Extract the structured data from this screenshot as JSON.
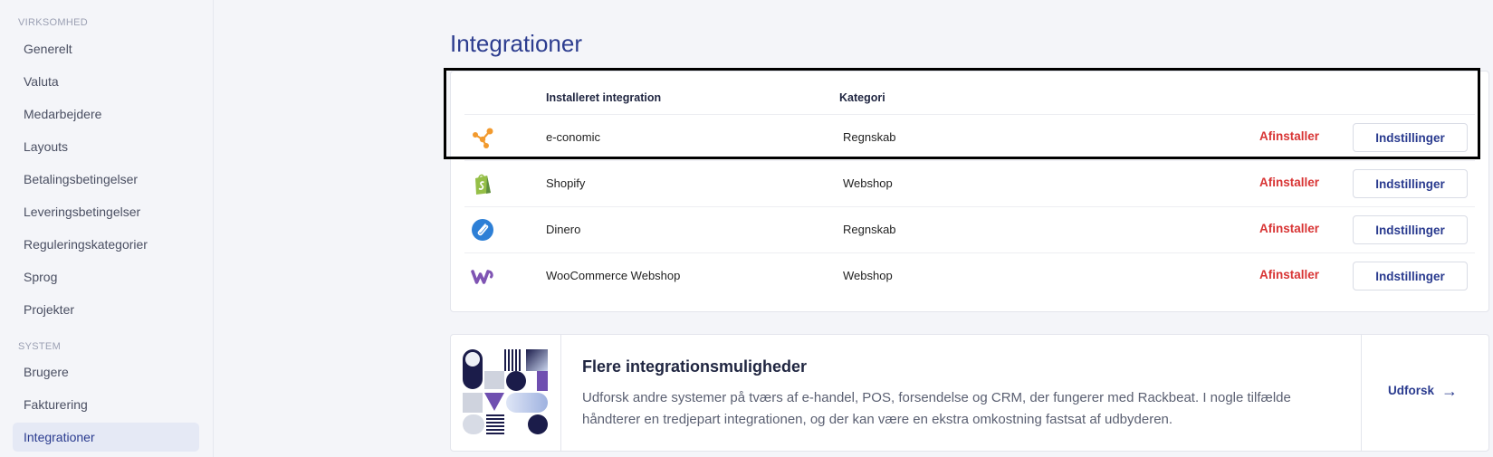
{
  "sidebar": {
    "sections": [
      {
        "label": "VIRKSOMHED",
        "items": [
          {
            "label": "Generelt"
          },
          {
            "label": "Valuta"
          },
          {
            "label": "Medarbejdere"
          },
          {
            "label": "Layouts"
          },
          {
            "label": "Betalingsbetingelser"
          },
          {
            "label": "Leveringsbetingelser"
          },
          {
            "label": "Reguleringskategorier"
          },
          {
            "label": "Sprog"
          },
          {
            "label": "Projekter"
          }
        ]
      },
      {
        "label": "SYSTEM",
        "items": [
          {
            "label": "Brugere"
          },
          {
            "label": "Fakturering"
          },
          {
            "label": "Integrationer",
            "active": true
          }
        ]
      }
    ]
  },
  "main": {
    "title": "Integrationer",
    "table": {
      "columns": [
        "Installeret integration",
        "Kategori"
      ],
      "uninstall_label": "Afinstaller",
      "settings_label": "Indstillinger",
      "rows": [
        {
          "name": "e-conomic",
          "category": "Regnskab",
          "icon": "e-conomic-logo-icon"
        },
        {
          "name": "Shopify",
          "category": "Webshop",
          "icon": "shopify-logo-icon"
        },
        {
          "name": "Dinero",
          "category": "Regnskab",
          "icon": "dinero-logo-icon"
        },
        {
          "name": "WooCommerce Webshop",
          "category": "Webshop",
          "icon": "woocommerce-logo-icon"
        }
      ]
    },
    "promo": {
      "title": "Flere integrationsmuligheder",
      "description": "Udforsk andre systemer på tværs af e-handel, POS, forsendelse og CRM, der fungerer med Rackbeat. I nogle tilfælde håndterer en tredjepart integrationen, og der kan være en ekstra omkostning fastsat af udbyderen.",
      "action_label": "Udforsk"
    }
  },
  "colors": {
    "accent": "#2a3b8f",
    "danger": "#d83434",
    "active_bg": "#e5e9f5"
  }
}
